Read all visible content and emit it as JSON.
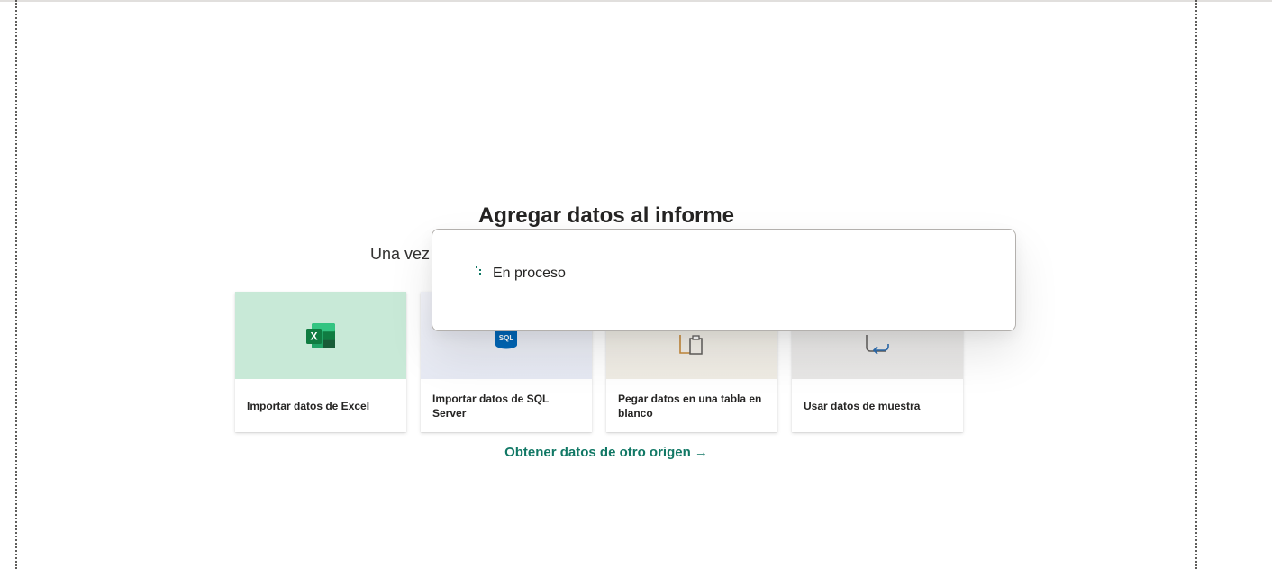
{
  "main": {
    "title": "Agregar datos al informe",
    "subtitle": "Una vez"
  },
  "cards": [
    {
      "label": "Importar datos de Excel",
      "icon": "excel-icon",
      "art_color": "#c8e9d7"
    },
    {
      "label": "Importar datos de SQL Server",
      "icon": "sql-server-icon",
      "icon_text": "SQL"
    },
    {
      "label": "Pegar datos en una tabla en blanco",
      "icon": "paste-table-icon"
    },
    {
      "label": "Usar datos de muestra",
      "icon": "sample-data-icon"
    }
  ],
  "other_source": {
    "label": "Obtener datos de otro origen →"
  },
  "loading_dialog": {
    "status_text": "En proceso"
  },
  "colors": {
    "accent": "#117865",
    "excel_green": "#107c41",
    "sql_blue": "#0067b8"
  }
}
